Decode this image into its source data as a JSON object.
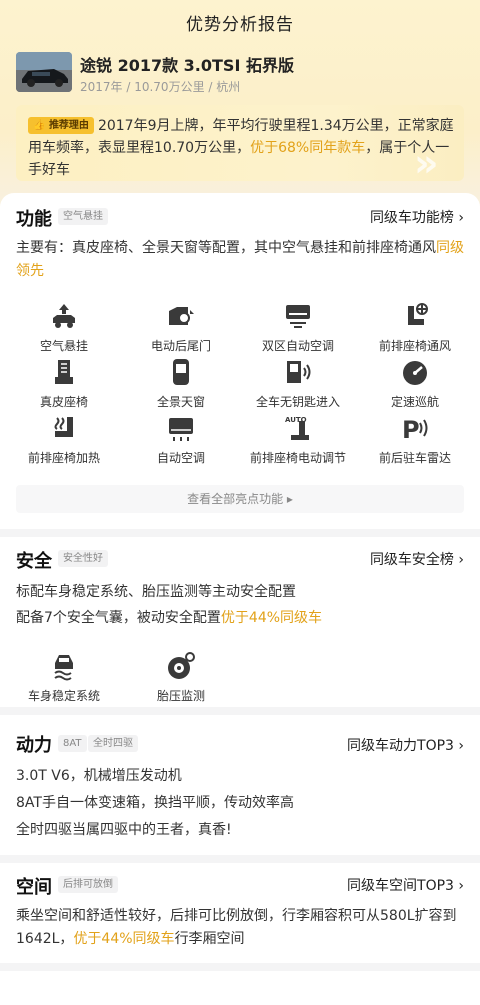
{
  "header": {
    "title": "优势分析报告"
  },
  "car": {
    "name": "途锐 2017款 3.0TSI 拓界版",
    "meta": "2017年 / 10.70万公里 / 杭州"
  },
  "recommend": {
    "tag": "推荐理由",
    "text_1": "2017年9月上牌，年平均行驶里程1.34万公里，正常家庭用车频率，表显里程10.70万公里，",
    "highlight": "优于68%同年款车",
    "text_2": "，属于个人一手好车"
  },
  "function_section": {
    "title": "功能",
    "tag": "空气悬挂",
    "link": "同级车功能榜 ›",
    "desc_1": "主要有：真皮座椅、全景天窗等配置，其中空气悬挂和前排座椅通风",
    "desc_hl": "同级领先",
    "features": [
      {
        "label": "空气悬挂",
        "icon": "air-suspension-icon"
      },
      {
        "label": "电动后尾门",
        "icon": "power-tailgate-icon"
      },
      {
        "label": "双区自动空调",
        "icon": "dual-zone-ac-icon"
      },
      {
        "label": "前排座椅通风",
        "icon": "seat-ventilation-icon"
      },
      {
        "label": "真皮座椅",
        "icon": "leather-seat-icon"
      },
      {
        "label": "全景天窗",
        "icon": "panoramic-sunroof-icon"
      },
      {
        "label": "全车无钥匙进入",
        "icon": "keyless-entry-icon"
      },
      {
        "label": "定速巡航",
        "icon": "cruise-control-icon"
      },
      {
        "label": "前排座椅加热",
        "icon": "seat-heating-icon"
      },
      {
        "label": "自动空调",
        "icon": "auto-ac-icon"
      },
      {
        "label": "前排座椅电动调节",
        "icon": "power-seat-adjust-icon"
      },
      {
        "label": "前后驻车雷达",
        "icon": "parking-radar-icon"
      }
    ],
    "view_all": "查看全部亮点功能 ▸"
  },
  "safety_section": {
    "title": "安全",
    "tag": "安全性好",
    "link": "同级车安全榜 ›",
    "line_1": "标配车身稳定系统、胎压监测等主动安全配置",
    "line_2a": "配备7个安全气囊，被动安全配置",
    "line_2hl": "优于44%同级车",
    "features": [
      {
        "label": "车身稳定系统",
        "icon": "stability-control-icon"
      },
      {
        "label": "胎压监测",
        "icon": "tire-pressure-icon"
      }
    ]
  },
  "power_section": {
    "title": "动力",
    "tag_1": "8AT",
    "tag_2": "全时四驱",
    "link": "同级车动力TOP3 ›",
    "lines": [
      "3.0T V6，机械增压发动机",
      "8AT手自一体变速箱，换挡平顺，传动效率高",
      "全时四驱当属四驱中的王者，真香!"
    ]
  },
  "space_section": {
    "title": "空间",
    "tag": "后排可放倒",
    "link": "同级车空间TOP3 ›",
    "text_1": "乘坐空间和舒适性较好，后排可比例放倒，行李厢容积可从580L扩容到1642L，",
    "text_hl": "优于44%同级车",
    "text_2": "行李厢空间"
  },
  "colors": {
    "accent": "#e2a21a",
    "tag": "#f6c02e",
    "banner": "#fdf0c2"
  }
}
